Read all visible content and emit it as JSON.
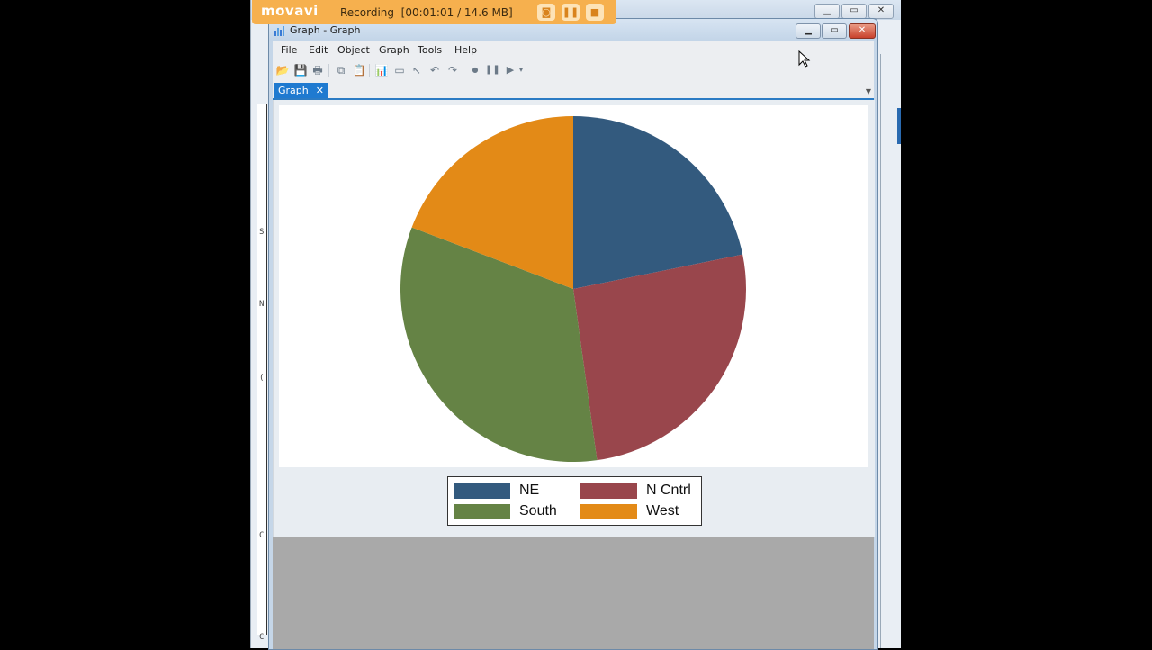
{
  "recorder": {
    "logo": "movavi",
    "status": "Recording",
    "timer": "[00:01:01 / 14.6 MB]",
    "buttons": [
      "screenshot",
      "pause",
      "stop"
    ],
    "color": "#f6b04e"
  },
  "window": {
    "title": "Graph - Graph",
    "controls": {
      "minimize": "▁",
      "maximize": "▭",
      "close": "✕"
    }
  },
  "menu": [
    "File",
    "Edit",
    "Object",
    "Graph",
    "Tools",
    "Help"
  ],
  "toolbar": [
    {
      "icon": "open-icon",
      "glyph": "📂"
    },
    {
      "icon": "save-icon",
      "glyph": "💾"
    },
    {
      "icon": "print-icon",
      "glyph": "🖶"
    },
    {
      "icon": "copy-icon",
      "glyph": "⧉"
    },
    {
      "icon": "paste-icon",
      "glyph": "📋"
    },
    {
      "icon": "graph-editor-icon",
      "glyph": "📊"
    },
    {
      "icon": "rename-icon",
      "glyph": "▭"
    },
    {
      "icon": "pointer-icon",
      "glyph": "↖"
    },
    {
      "icon": "undo-icon",
      "glyph": "↶"
    },
    {
      "icon": "redo-icon",
      "glyph": "↷"
    },
    {
      "icon": "record-icon",
      "glyph": "●"
    },
    {
      "icon": "pause-icon",
      "glyph": "❚❚"
    },
    {
      "icon": "play-icon",
      "glyph": "▶"
    },
    {
      "icon": "more-icon",
      "glyph": "▾"
    }
  ],
  "tabs": [
    {
      "label": "Graph",
      "close": "✕"
    }
  ],
  "background": {
    "left_chars": [
      "S",
      "N",
      "(",
      "C",
      "C"
    ],
    "controls": {
      "minimize": "▁",
      "maximize": "▭",
      "close": "✕"
    }
  },
  "chart_data": {
    "type": "pie",
    "title": "",
    "start": "12 o'clock",
    "direction": "clockwise",
    "legend_position": "bottom",
    "legend_columns": 2,
    "slices": [
      {
        "label": "NE",
        "value": 21.8,
        "color": "#335a7e"
      },
      {
        "label": "N Cntrl",
        "value": 26.0,
        "color": "#99464c"
      },
      {
        "label": "South",
        "value": 33.0,
        "color": "#658345"
      },
      {
        "label": "West",
        "value": 19.2,
        "color": "#e38a17"
      }
    ],
    "unit": "percent (estimated)"
  }
}
